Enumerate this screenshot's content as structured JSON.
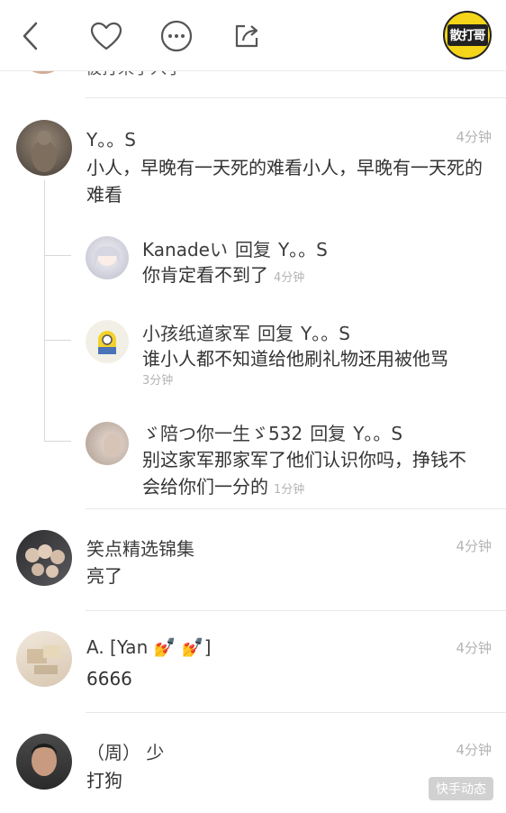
{
  "header": {
    "back_icon": "back-chevron-icon",
    "like_icon": "heart-icon",
    "more_icon": "more-dots-icon",
    "share_icon": "share-icon",
    "badge_label": "散打哥"
  },
  "clipped_text": "被打来了入了",
  "comments": [
    {
      "name": "Y。。S",
      "time": "4分钟",
      "text": "小人，早晚有一天死的难看小人，早晚有一天死的难看",
      "replies": [
        {
          "name": "Kanadeい",
          "reply_word": "回复",
          "reply_to": "Y。。S",
          "text": "你肯定看不到了",
          "time": "4分钟"
        },
        {
          "name": "小孩纸道家军",
          "reply_word": "回复",
          "reply_to": "Y。。S",
          "text": "谁小人都不知道给他刷礼物还用被他骂",
          "time": "3分钟"
        },
        {
          "name": "ゞ陪つ你一生ゞ532",
          "reply_word": "回复",
          "reply_to": "Y。。S",
          "text": "别这家军那家军了他们认识你吗，挣钱不会给你们一分的",
          "time": "1分钟"
        }
      ]
    },
    {
      "name": "笑点精选锦集",
      "time": "4分钟",
      "text": "亮了"
    },
    {
      "name": "A.  [Yan 💅 💅]",
      "time": "4分钟",
      "text": "6666"
    },
    {
      "name": "（周） 少",
      "time": "4分钟",
      "text": "打狗"
    }
  ],
  "watermark": "快手动态"
}
